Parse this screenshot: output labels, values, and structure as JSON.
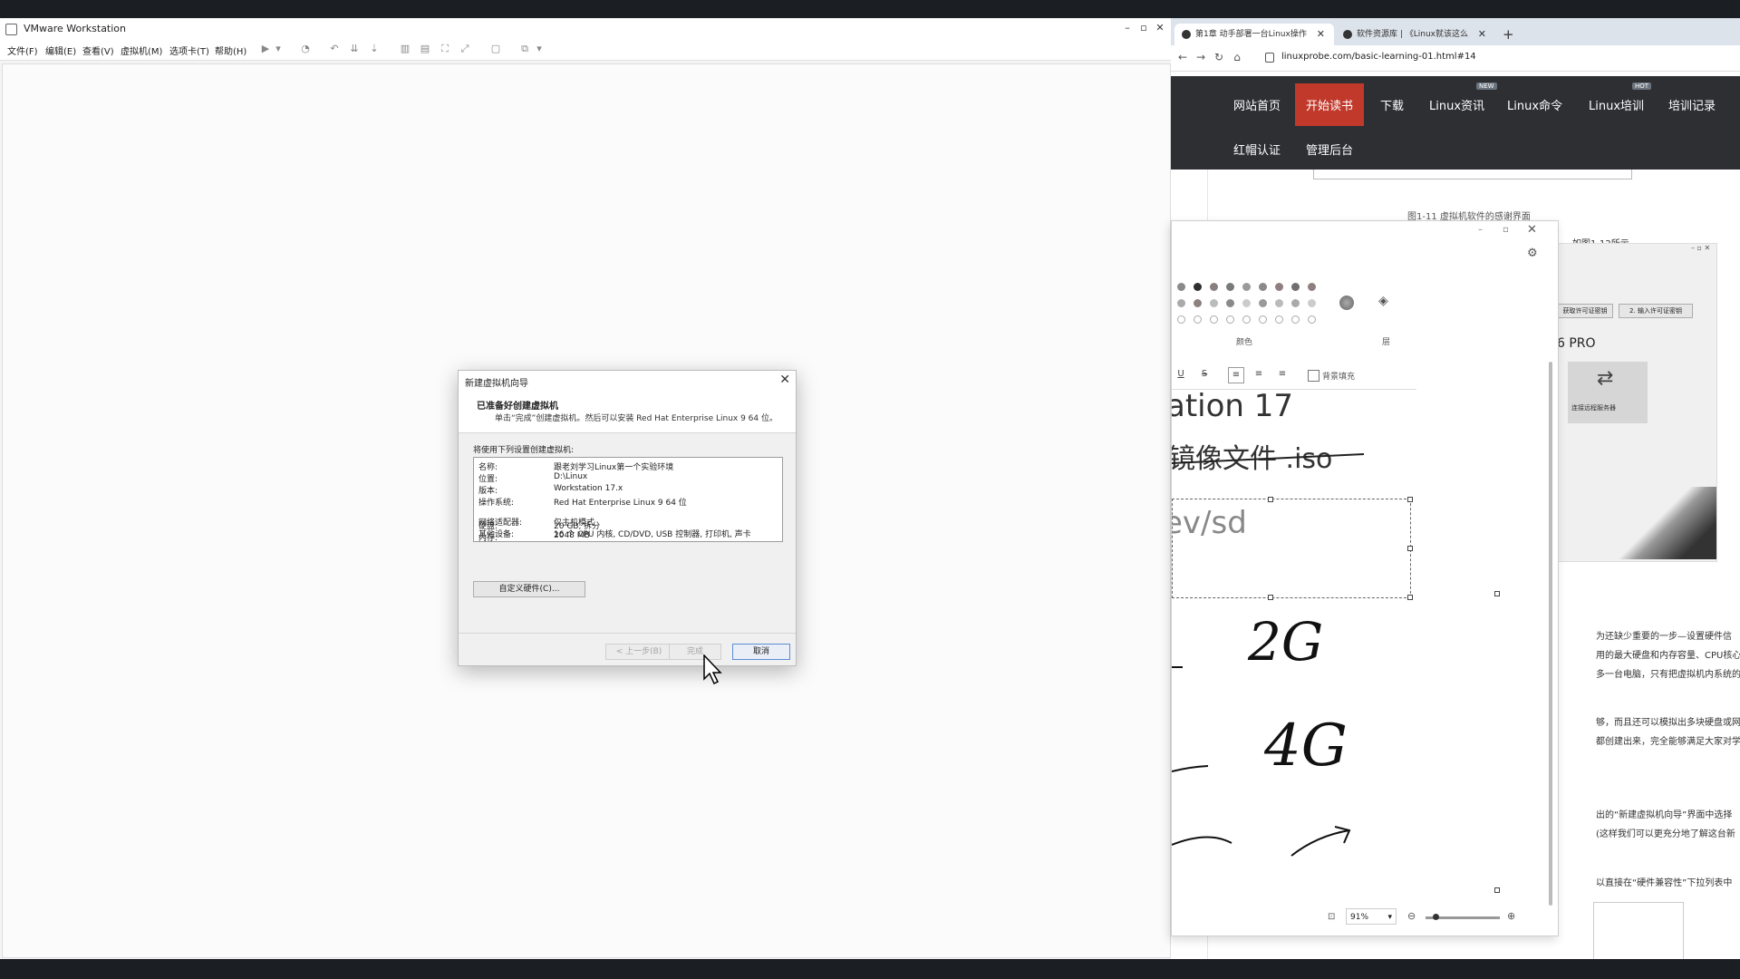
{
  "vmware": {
    "title": "VMware Workstation",
    "menu": [
      "文件(F)",
      "编辑(E)",
      "查看(V)",
      "虚拟机(M)",
      "选项卡(T)",
      "帮助(H)"
    ]
  },
  "dialog": {
    "title": "新建虚拟机向导",
    "heading": "已准备好创建虚拟机",
    "subheading": "单击“完成”创建虚拟机。然后可以安装 Red Hat Enterprise Linux 9 64 位。",
    "lead": "将使用下列设置创建虚拟机:",
    "settings": [
      {
        "k": "名称:",
        "v": "跟老刘学习Linux第一个实验环境"
      },
      {
        "k": "位置:",
        "v": "D:\\Linux"
      },
      {
        "k": "版本:",
        "v": "Workstation 17.x"
      },
      {
        "k": "操作系统:",
        "v": "Red Hat Enterprise Linux 9 64 位"
      },
      {
        "k": "硬盘:",
        "v": "20 GB, 拆分"
      },
      {
        "k": "内存:",
        "v": "2048 MB"
      },
      {
        "k": "网络适配器:",
        "v": "仅主机模式"
      },
      {
        "k": "其他设备:",
        "v": "16 个 CPU 内核, CD/DVD, USB 控制器, 打印机, 声卡"
      }
    ],
    "customize_label": "自定义硬件(C)...",
    "back_label": "< 上一步(B)",
    "finish_label": "完成",
    "cancel_label": "取消"
  },
  "browser": {
    "tabs": [
      {
        "label": "第1章 动手部署一台Linux操作"
      },
      {
        "label": "软件资源库 | 《Linux就该这么"
      }
    ],
    "url": "linuxprobe.com/basic-learning-01.html#14",
    "nav": [
      "网站首页",
      "开始读书",
      "下载",
      "Linux资讯",
      "Linux命令",
      "Linux培训",
      "培训记录",
      "红帽认证",
      "管理后台"
    ],
    "nav_tags": {
      "new": "NEW",
      "hot": "HOT"
    },
    "caption": "图1-11  虚拟机软件的感谢界面",
    "caption_tail": "如图1-12所示。",
    "side_snippets": [
      "为还缺少重要的一步—设置硬件信",
      "用的最大硬盘和内存容量、CPU核心",
      "多一台电脑，只有把虚拟机内系统的",
      "够，而且还可以模拟出多块硬盘或网",
      "都创建出来，完全能够满足大家对学",
      "出的“新建虚拟机向导”界面中选择",
      "(这样我们可以更充分地了解这台新",
      "以直接在“硬件兼容性”下拉列表中"
    ],
    "image_labels": {
      "btn1": "获取许可证密钥",
      "btn2": "2. 输入许可证密钥",
      "pro": "6 PRO",
      "connect": "连接远程服务器"
    }
  },
  "annotator": {
    "color_label": "颜色",
    "layer_label": "层",
    "bg_fill_label": "背景填充",
    "big_text_1": "ation 17",
    "big_text_2": "镜像文件 .iso",
    "big_text_3": "ev/sd",
    "hand_1": "2G",
    "hand_2": "4G",
    "zoom": "91%",
    "colors_row1": [
      "#8a8a8a",
      "#2f2f2f",
      "#8a7f7f",
      "#7a7a7a",
      "#9a9a9a",
      "#8a8a8a",
      "#8f7f7f",
      "#6f6f6f",
      "#8f7f7f"
    ],
    "colors_row2": [
      "#aaaaaa",
      "#8f8080",
      "#bbbbbb",
      "#8a8a8a",
      "#cccccc",
      "#9a9a9a",
      "#bbbbbb",
      "#aaaaaa",
      "#cccccc"
    ]
  }
}
